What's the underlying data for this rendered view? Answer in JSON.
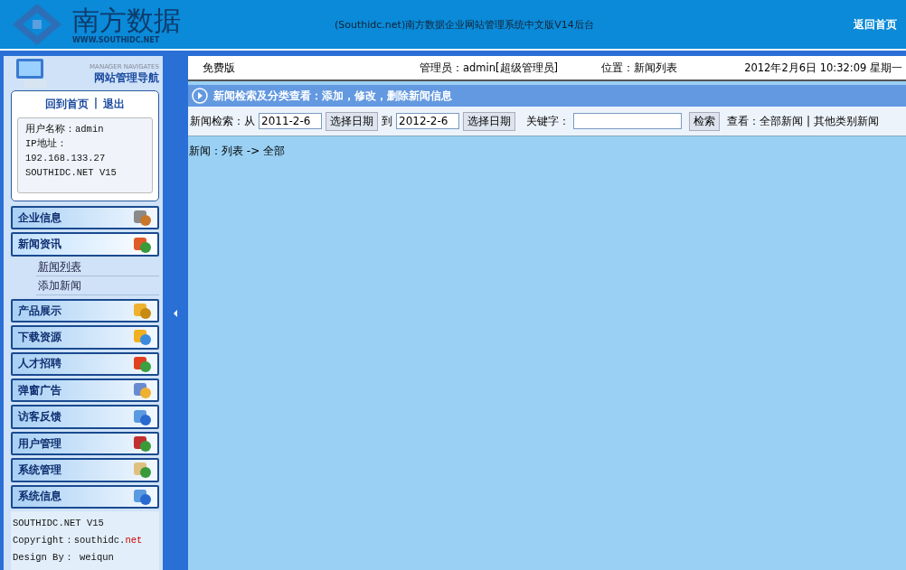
{
  "header": {
    "logo_name": "南方数据",
    "logo_url": "WWW.SOUTHIDC.NET",
    "title": "(Southidc.net)南方数据企业网站管理系统中文版V14后台",
    "home_link": "返回首页"
  },
  "sidebar": {
    "caption_en": "MANAGER NAVIGATES",
    "caption": "网站管理导航",
    "links": [
      "回到首页",
      "退出"
    ],
    "link_separator": "|",
    "user_lines": [
      "用户名称：admin",
      "IP地址：",
      "192.168.133.27",
      "SOUTHIDC.NET V15"
    ],
    "sections": [
      {
        "label": "企业信息",
        "kind": "tools",
        "expanded": false
      },
      {
        "label": "新闻资讯",
        "kind": "people",
        "expanded": true,
        "children": [
          {
            "label": "新闻列表",
            "selected": true
          },
          {
            "label": "添加新闻",
            "selected": false
          }
        ]
      },
      {
        "label": "产品展示",
        "kind": "lock",
        "expanded": false
      },
      {
        "label": "下载资源",
        "kind": "gears",
        "expanded": false
      },
      {
        "label": "人才招聘",
        "kind": "arrows",
        "expanded": false
      },
      {
        "label": "弹窗广告",
        "kind": "cursor",
        "expanded": false
      },
      {
        "label": "访客反馈",
        "kind": "info",
        "expanded": false
      },
      {
        "label": "用户管理",
        "kind": "house",
        "expanded": false
      },
      {
        "label": "系统管理",
        "kind": "person",
        "expanded": false
      },
      {
        "label": "系统信息",
        "kind": "info",
        "expanded": false
      }
    ],
    "footer": [
      {
        "text": "SOUTHIDC.NET V15"
      },
      {
        "text": "Copyright：southidc.",
        "highlight": "net"
      },
      {
        "text": "Design By： weiqun"
      }
    ]
  },
  "info_bar": {
    "edition": "免费版",
    "admin": "管理员：admin[超级管理员]",
    "location": "位置：新闻列表",
    "datetime": "2012年2月6日 10:32:09 星期一"
  },
  "panel_title": "新闻检索及分类查看：添加，修改，删除新闻信息",
  "search": {
    "label": "新闻检索：从",
    "from": "2011-2-6",
    "pick_button": "选择日期",
    "to_label": "到",
    "to": "2012-2-6",
    "pick_button_2": "选择日期",
    "keyword_label": "关键字：",
    "search_button": "检索",
    "view_label": "查看：全部新闻",
    "view_separator": "|",
    "view_other": "其他类别新闻"
  },
  "breadcrumb": "新闻：列表 -> 全部"
}
